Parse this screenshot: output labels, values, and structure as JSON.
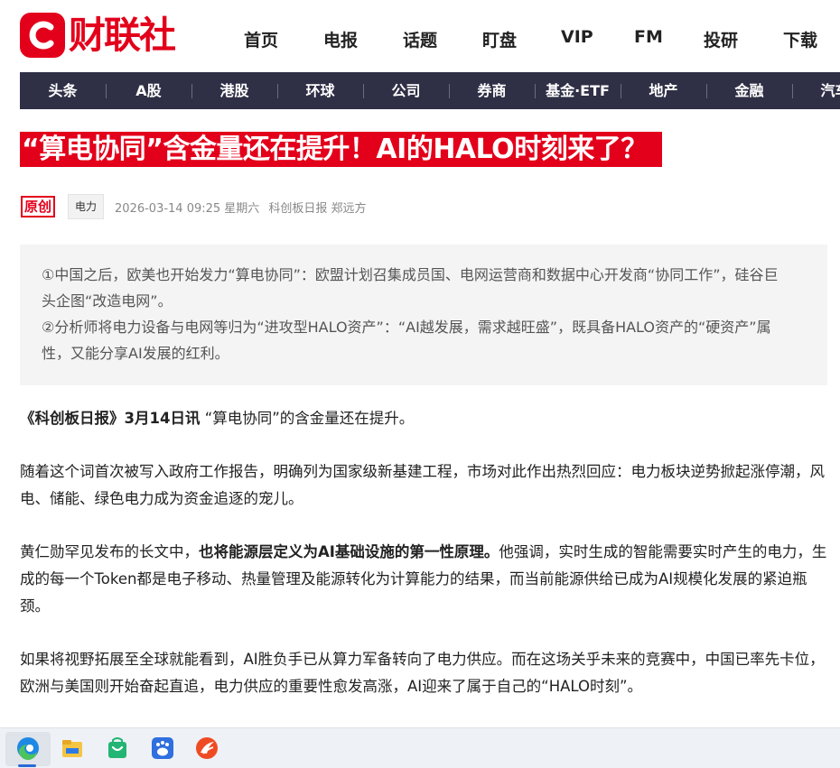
{
  "header": {
    "logo_text": "财联社",
    "nav": [
      "首页",
      "电报",
      "话题",
      "盯盘",
      "VIP",
      "FM",
      "投研",
      "下载"
    ]
  },
  "categories": [
    "头条",
    "A股",
    "港股",
    "环球",
    "公司",
    "券商",
    "基金·ETF",
    "地产",
    "金融",
    "汽车"
  ],
  "article": {
    "title": "“算电协同”含金量还在提升！AI的HALO时刻来了？",
    "badge": "原创",
    "tag": "电力",
    "datetime": "2026-03-14 09:25 星期六",
    "source": "科创板日报 郑远方",
    "summary": [
      "①中国之后，欧美也开始发力“算电协同”：欧盟计划召集成员国、电网运营商和数据中心开发商“协同工作”，硅谷巨头企图“改造电网”。",
      "②分析师将电力设备与电网等归为“进攻型HALO资产”：“AI越发展，需求越旺盛”，既具备HALO资产的“硬资产”属性，又能分享AI发展的红利。"
    ],
    "p1_bold": "《科创板日报》3月14日讯",
    "p1_rest": " “算电协同”的含金量还在提升。",
    "p2": "随着这个词首次被写入政府工作报告，明确列为国家级新基建工程，市场对此作出热烈回应：电力板块逆势掀起涨停潮，风电、储能、绿色电力成为资金追逐的宠儿。",
    "p3_pre": "黄仁勋罕见发布的长文中，",
    "p3_bold": "也将能源层定义为AI基础设施的第一性原理。",
    "p3_post": "他强调，实时生成的智能需要实时产生的电力，生成的每一个Token都是电子移动、热量管理及能源转化为计算能力的结果，而当前能源供给已成为AI规模化发展的紧迫瓶颈。",
    "p4": "如果将视野拓展至全球就能看到，AI胜负手已从算力军备转向了电力供应。而在这场关乎未来的竞赛中，中国已率先卡位，欧洲与美国则开始奋起直追，电力供应的重要性愈发高涨，AI迎来了属于自己的“HALO时刻”。"
  },
  "taskbar": {
    "icons": [
      "edge-browser-icon",
      "file-explorer-icon",
      "store-bag-icon",
      "baidu-netdisk-icon",
      "news-app-icon"
    ]
  },
  "colors": {
    "brand_red": "#e3001b",
    "nav_bar": "#2f2f46",
    "summary_bg": "#f4f4f5"
  }
}
